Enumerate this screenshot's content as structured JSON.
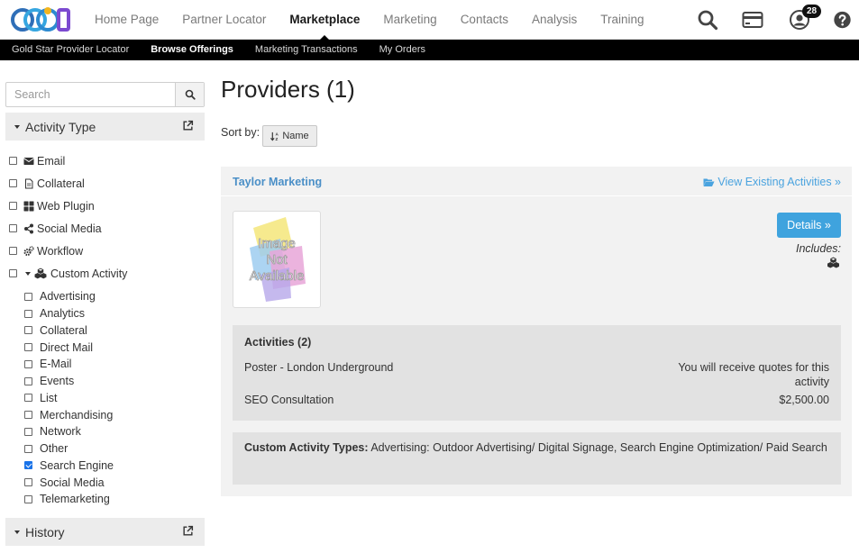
{
  "header": {
    "logo_text": "CCOE",
    "nav": [
      "Home Page",
      "Partner Locator",
      "Marketplace",
      "Marketing",
      "Contacts",
      "Analysis",
      "Training"
    ],
    "active_nav": "Marketplace",
    "notification_count": "28",
    "icons": [
      "search-icon",
      "credit-card-icon",
      "user-icon",
      "help-icon"
    ]
  },
  "subnav": [
    "Gold Star Provider Locator",
    "Browse Offerings",
    "Marketing Transactions",
    "My Orders"
  ],
  "sidebar": {
    "search_placeholder": "Search",
    "activity_type_title": "Activity Type",
    "activity_types": [
      {
        "label": "Email",
        "icon": "envelope-icon",
        "checked": false
      },
      {
        "label": "Collateral",
        "icon": "document-icon",
        "checked": false
      },
      {
        "label": "Web Plugin",
        "icon": "grid-icon",
        "checked": false
      },
      {
        "label": "Social Media",
        "icon": "share-icon",
        "checked": false
      },
      {
        "label": "Workflow",
        "icon": "gears-icon",
        "checked": false
      },
      {
        "label": "Custom Activity",
        "icon": "cubes-icon",
        "checked": false
      }
    ],
    "custom_activity_items": [
      {
        "label": "Advertising",
        "checked": false
      },
      {
        "label": "Analytics",
        "checked": false
      },
      {
        "label": "Collateral",
        "checked": false
      },
      {
        "label": "Direct Mail",
        "checked": false
      },
      {
        "label": "E-Mail",
        "checked": false
      },
      {
        "label": "Events",
        "checked": false
      },
      {
        "label": "List",
        "checked": false
      },
      {
        "label": "Merchandising",
        "checked": false
      },
      {
        "label": "Network",
        "checked": false
      },
      {
        "label": "Other",
        "checked": false
      },
      {
        "label": "Search Engine",
        "checked": true
      },
      {
        "label": "Social Media",
        "checked": false
      },
      {
        "label": "Telemarketing",
        "checked": false
      }
    ],
    "history_title": "History"
  },
  "main": {
    "title": "Providers (1)",
    "sort_label": "Sort by:",
    "sort_button": "Name",
    "provider": {
      "name": "Taylor Marketing",
      "view_link": "View Existing Activities »",
      "image_placeholder": "Image Not Available",
      "details_button": "Details »",
      "includes_label": "Includes:",
      "activities_title": "Activities (2)",
      "activities": [
        {
          "name": "Poster - London Underground",
          "price_line1": "You will receive quotes for this",
          "price_line2": "activity"
        },
        {
          "name": "SEO Consultation",
          "price_line1": "$2,500.00",
          "price_line2": ""
        }
      ],
      "custom_types_label": "Custom Activity Types:",
      "custom_types_value": "Advertising: Outdoor Advertising/ Digital Signage, Search Engine Optimization/ Paid Search"
    }
  },
  "colors": {
    "accent": "#3fa3de",
    "link": "#4a8fc7",
    "subnav_bg": "#000000",
    "panel_bg": "#f2f2f2"
  }
}
